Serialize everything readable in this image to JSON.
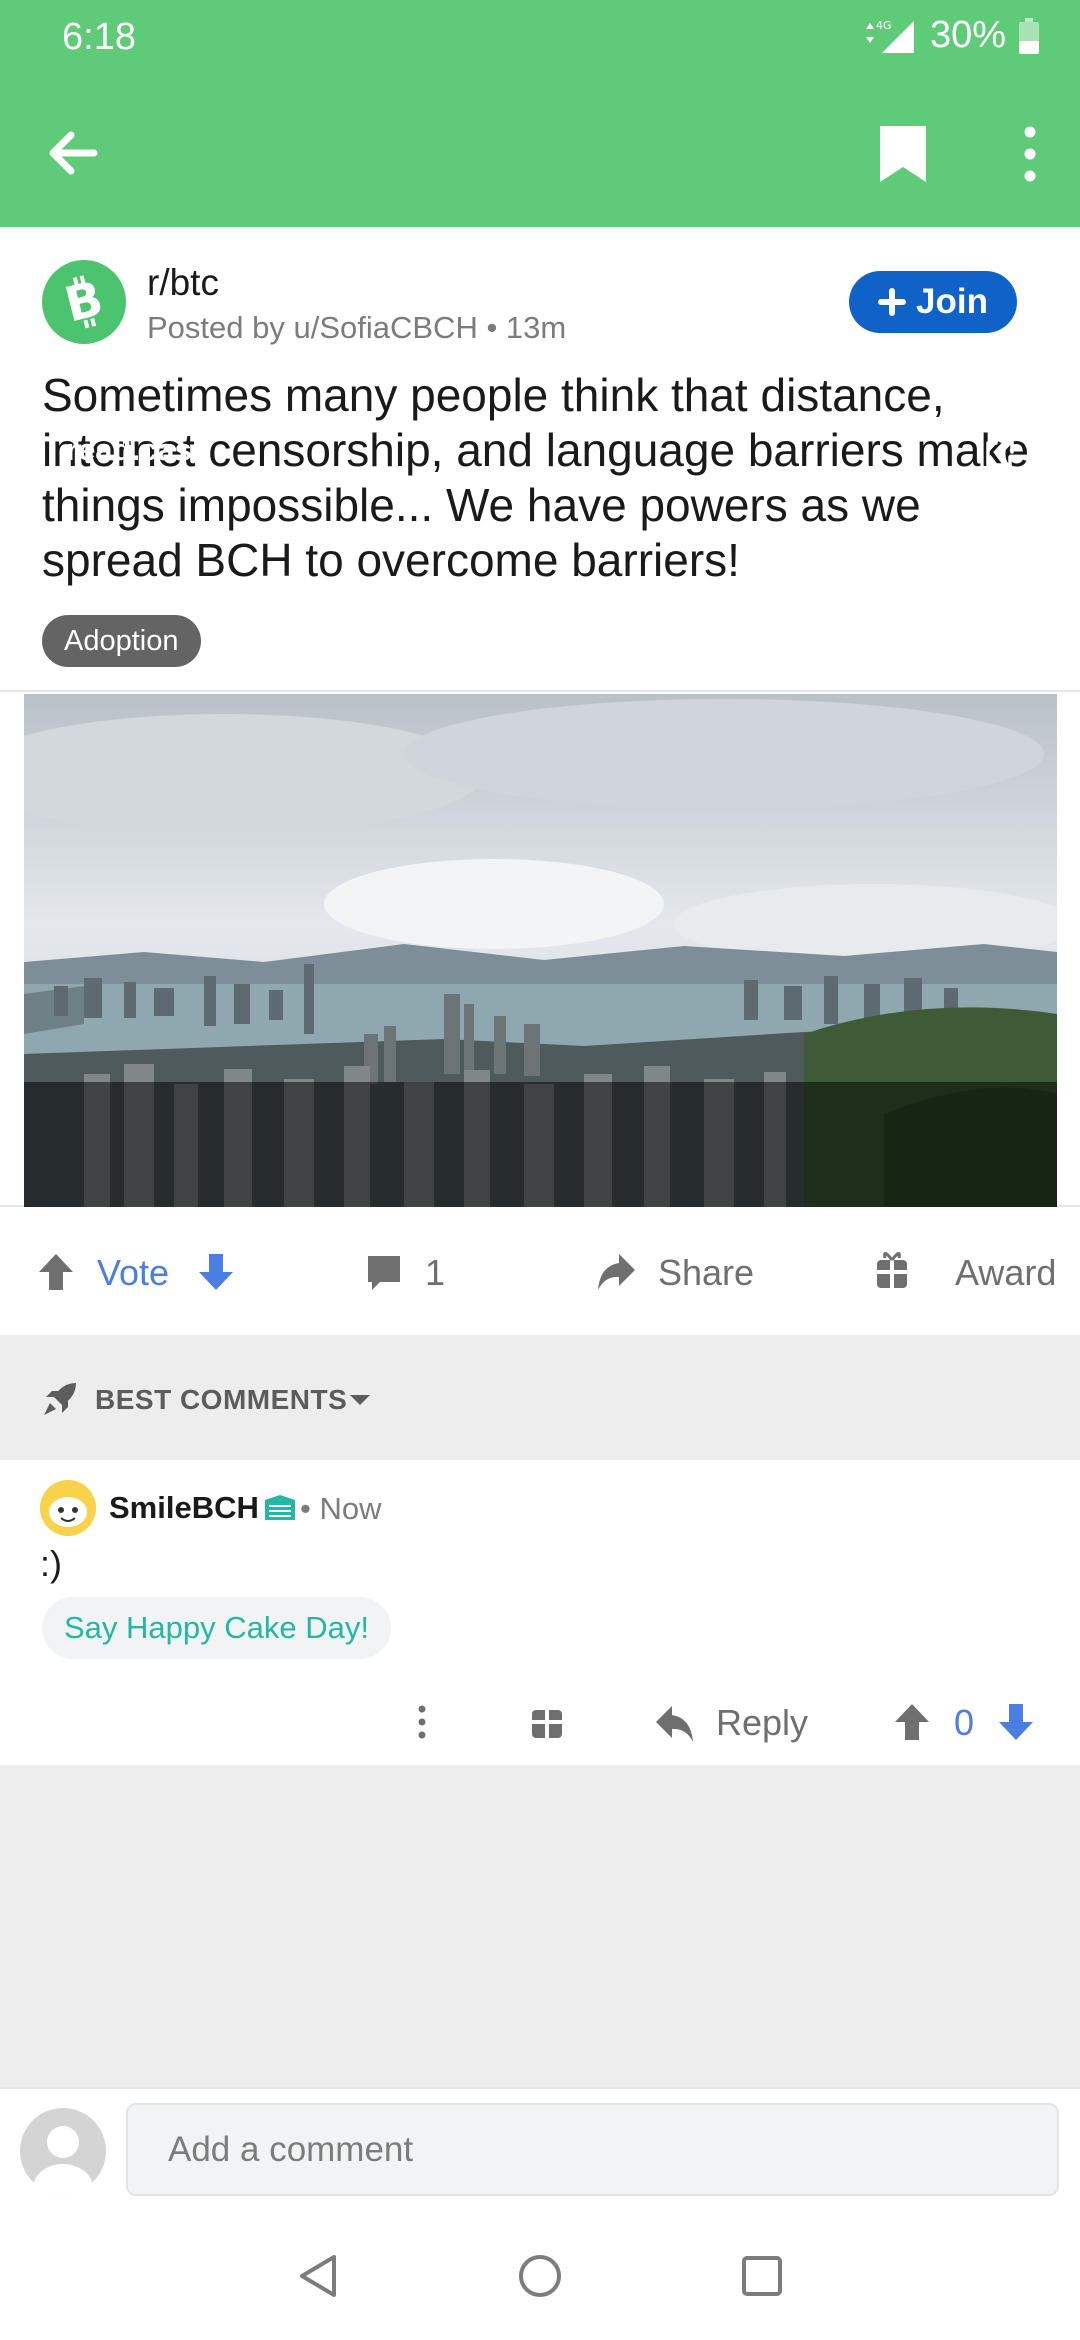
{
  "status_bar": {
    "time": "6:18",
    "network": "4G",
    "battery": "30%"
  },
  "header": {
    "back_icon": "arrow-left-icon",
    "bookmark_icon": "bookmark-icon",
    "overflow_icon": "more-vertical-icon",
    "color": "#5fca78"
  },
  "post": {
    "subreddit": "r/btc",
    "meta": "Posted by u/SofiaCBCH • 13m",
    "join_label": "Join",
    "title": "Sometimes many people think that distance, internet censorship, and language barriers make things impossible... We have powers as we spread BCH to overcome barriers!",
    "flair": "Adoption",
    "link_domain": "read.cash"
  },
  "actions": {
    "vote_label": "Vote",
    "comment_count": "1",
    "share_label": "Share",
    "award_label": "Award"
  },
  "comments_header": {
    "sort_label": "BEST COMMENTS"
  },
  "comment": {
    "author": "SmileBCH",
    "time": "• Now",
    "body": ":)",
    "cake_day_button": "Say Happy Cake Day!",
    "reply_label": "Reply",
    "score": "0"
  },
  "composer": {
    "placeholder": "Add a comment"
  },
  "colors": {
    "accent_blue": "#4a7ee3",
    "join_blue": "#0f63c8",
    "cake_teal": "#22b8a4",
    "bch_green": "#4cc46f"
  }
}
